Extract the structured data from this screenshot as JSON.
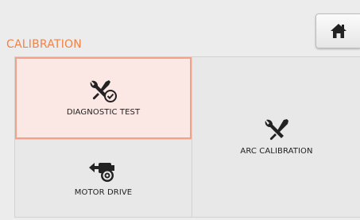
{
  "header": {
    "title": "CALIBRATION",
    "home_icon": "home-icon"
  },
  "tiles": [
    {
      "label": "DIAGNOSTIC TEST",
      "icon": "tools-check-icon",
      "selected": true
    },
    {
      "label": "ARC CALIBRATION",
      "icon": "tools-icon",
      "selected": false
    },
    {
      "label": "MOTOR DRIVE",
      "icon": "motor-drive-icon",
      "selected": false
    }
  ],
  "colors": {
    "accent": "#f0824a",
    "selected_fill": "#fbe7e3",
    "selected_border": "#f0a38a",
    "background": "#ececec"
  }
}
